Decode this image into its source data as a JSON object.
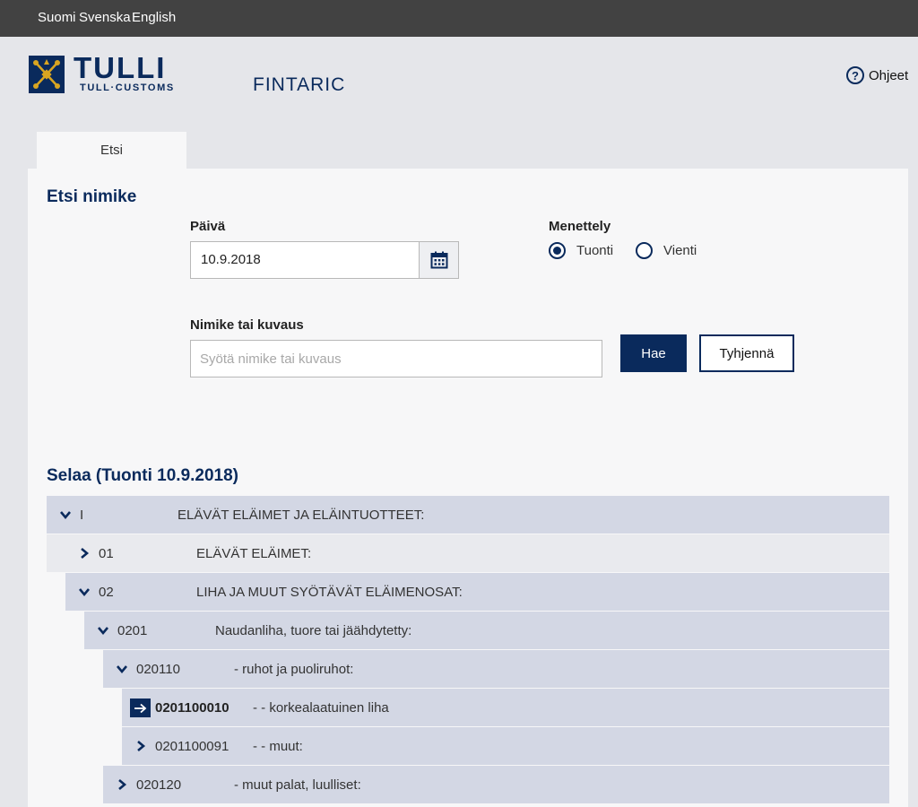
{
  "languages": [
    "Suomi",
    "Svenska",
    "English"
  ],
  "logo": {
    "main": "TULLI",
    "sub": "TULL·CUSTOMS"
  },
  "app_title": "FINTARIC",
  "help_label": "Ohjeet",
  "tab_label": "Etsi",
  "search_section": {
    "title": "Etsi nimike",
    "date_label": "Päivä",
    "date_value": "10.9.2018",
    "procedure_label": "Menettely",
    "procedure_options": [
      "Tuonti",
      "Vienti"
    ],
    "procedure_selected": "Tuonti",
    "query_label": "Nimike tai kuvaus",
    "query_placeholder": "Syötä nimike tai kuvaus",
    "query_value": "",
    "search_button": "Hae",
    "clear_button": "Tyhjennä"
  },
  "browse_title": "Selaa (Tuonti 10.9.2018)",
  "tree": [
    {
      "level": 0,
      "state": "expanded",
      "code": "I",
      "desc": "ELÄVÄT ELÄIMET JA ELÄINTUOTTEET:"
    },
    {
      "level": 1,
      "state": "collapsed",
      "code": "01",
      "desc": "ELÄVÄT ELÄIMET:"
    },
    {
      "level": 1,
      "state": "expanded",
      "code": "02",
      "desc": "LIHA JA MUUT SYÖTÄVÄT ELÄIMENOSAT:"
    },
    {
      "level": 2,
      "state": "expanded",
      "code": "0201",
      "desc": "Naudanliha, tuore tai jäähdytetty:"
    },
    {
      "level": 3,
      "state": "expanded",
      "code": "020110",
      "desc": "- ruhot ja puoliruhot:"
    },
    {
      "level": 4,
      "state": "leaf",
      "code": "0201100010",
      "desc": "- - korkealaatuinen liha"
    },
    {
      "level": 4,
      "state": "collapsed",
      "code": "0201100091",
      "desc": "- - muut:"
    },
    {
      "level": 3,
      "state": "collapsed",
      "code": "020120",
      "desc": "- muut palat, luulliset:"
    }
  ],
  "colors": {
    "brand": "#0a2a5c",
    "row_bg": "#d3d7e4",
    "row_bg_alt": "#e9eaee",
    "topbar": "#424242"
  }
}
